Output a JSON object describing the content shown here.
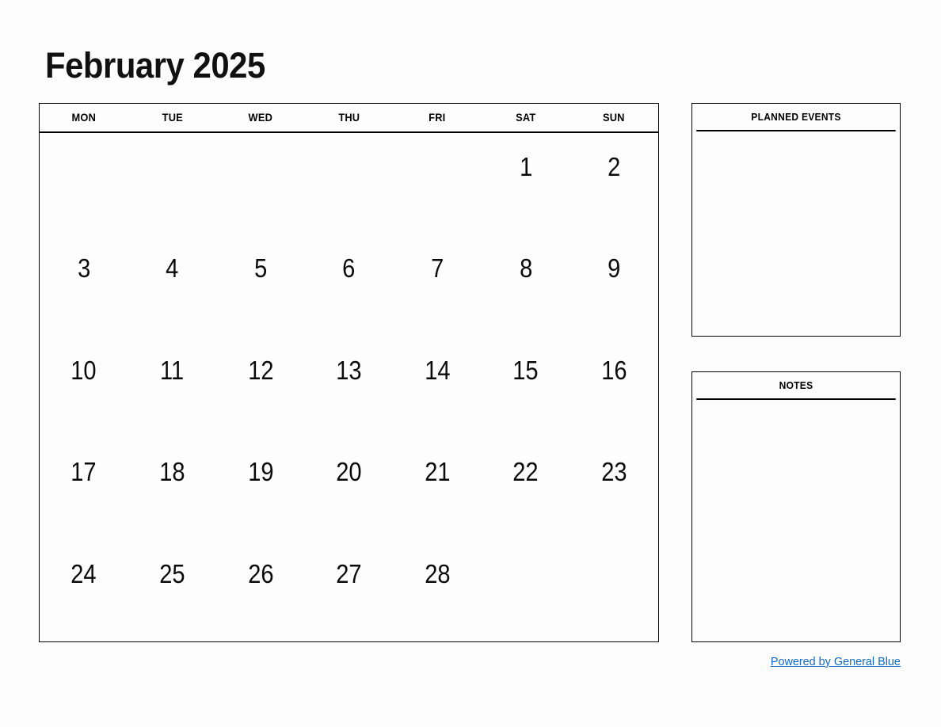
{
  "document": {
    "title": "February 2025",
    "month": "February",
    "year": "2025"
  },
  "calendar": {
    "weekday_headers": [
      "MON",
      "TUE",
      "WED",
      "THU",
      "FRI",
      "SAT",
      "SUN"
    ],
    "weeks": [
      [
        "",
        "",
        "",
        "",
        "",
        "1",
        "2"
      ],
      [
        "3",
        "4",
        "5",
        "6",
        "7",
        "8",
        "9"
      ],
      [
        "10",
        "11",
        "12",
        "13",
        "14",
        "15",
        "16"
      ],
      [
        "17",
        "18",
        "19",
        "20",
        "21",
        "22",
        "23"
      ],
      [
        "24",
        "25",
        "26",
        "27",
        "28",
        "",
        ""
      ]
    ]
  },
  "panels": {
    "planned_events": {
      "header": "PLANNED EVENTS",
      "content": ""
    },
    "notes": {
      "header": "NOTES",
      "content": ""
    }
  },
  "footer": {
    "link_text": "Powered by General Blue"
  },
  "colors": {
    "page_background": "#fdfdfd",
    "border": "#000000",
    "text": "#0a0a0a",
    "link": "#1269c8"
  }
}
